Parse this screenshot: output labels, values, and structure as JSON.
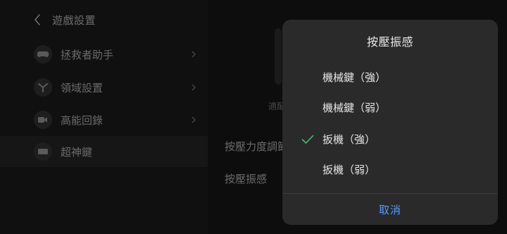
{
  "header": {
    "title": "遊戲設置"
  },
  "sidebar": {
    "items": [
      {
        "label": "拯救者助手",
        "icon": "gamepad-icon"
      },
      {
        "label": "領域設置",
        "icon": "legion-logo-icon"
      },
      {
        "label": "高能回錄",
        "icon": "video-camera-icon"
      },
      {
        "label": "超神鍵",
        "icon": "keyboard-icon"
      }
    ]
  },
  "content": {
    "caption": "適配",
    "rows": [
      {
        "label": "按壓力度調節"
      },
      {
        "label": "按壓振感"
      }
    ]
  },
  "modal": {
    "title": "按壓振感",
    "options": [
      {
        "label": "機械鍵（強）",
        "selected": false
      },
      {
        "label": "機械鍵（弱）",
        "selected": false
      },
      {
        "label": "扳機（強）",
        "selected": true
      },
      {
        "label": "扳機（弱）",
        "selected": false
      }
    ],
    "cancel_label": "取消"
  },
  "colors": {
    "accent": "#5b9cf2",
    "check": "#3fbf6f",
    "modal_bg": "#2a2a2b"
  }
}
